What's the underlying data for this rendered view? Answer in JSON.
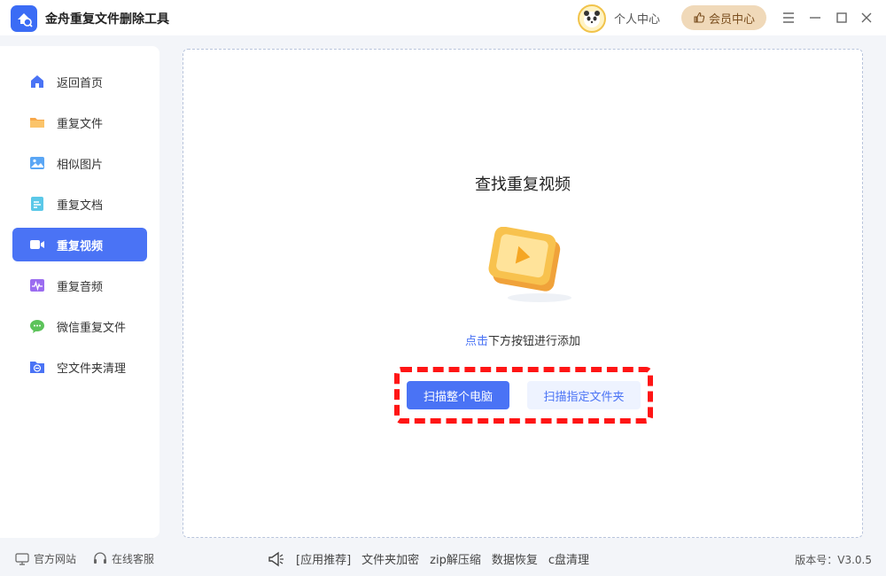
{
  "app": {
    "title": "金舟重复文件删除工具",
    "accent": "#4a73f5"
  },
  "header": {
    "user_center": "个人中心",
    "vip_center": "会员中心"
  },
  "sidebar": {
    "items": [
      {
        "label": "返回首页",
        "icon": "home-icon"
      },
      {
        "label": "重复文件",
        "icon": "folder-icon"
      },
      {
        "label": "相似图片",
        "icon": "image-icon"
      },
      {
        "label": "重复文档",
        "icon": "document-icon"
      },
      {
        "label": "重复视频",
        "icon": "video-icon",
        "active": true
      },
      {
        "label": "重复音频",
        "icon": "audio-icon"
      },
      {
        "label": "微信重复文件",
        "icon": "wechat-icon"
      },
      {
        "label": "空文件夹清理",
        "icon": "empty-folder-icon"
      }
    ]
  },
  "main": {
    "title": "查找重复视频",
    "hint_link": "点击",
    "hint_rest": "下方按钮进行添加",
    "scan_all_button": "扫描整个电脑",
    "scan_folder_button": "扫描指定文件夹"
  },
  "footer": {
    "official_site": "官方网站",
    "online_service": "在线客服",
    "promo_label": "[应用推荐]",
    "promo_items": [
      "文件夹加密",
      "zip解压缩",
      "数据恢复",
      "c盘清理"
    ],
    "version": "版本号：V3.0.5"
  }
}
